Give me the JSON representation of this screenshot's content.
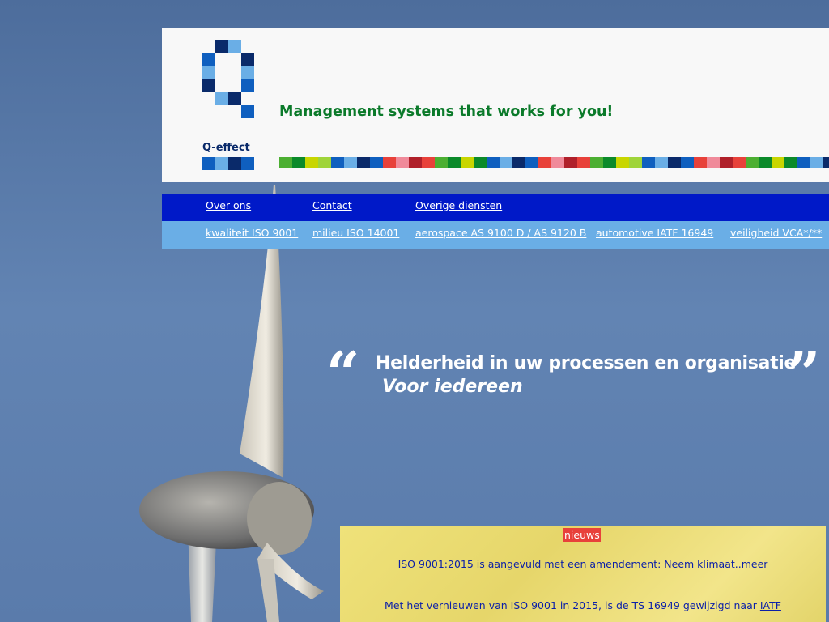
{
  "brand": {
    "name": "Q-effect",
    "tagline": "Management systems that works for you!",
    "colors": {
      "dark_blue": "#0a2a6a",
      "mid_blue": "#0f5fbf",
      "light_blue": "#6aaee6",
      "green": "#0b7a2a"
    }
  },
  "nav": {
    "primary": [
      {
        "label": "Over ons"
      },
      {
        "label": "Contact "
      },
      {
        "label": "Overige diensten "
      }
    ],
    "secondary": [
      {
        "label": "kwaliteit  ISO 9001"
      },
      {
        "label": "milieu  ISO 14001"
      },
      {
        "label": "aerospace  AS 9100 D / AS 9120 B"
      },
      {
        "label": "automotive  IATF 16949"
      },
      {
        "label": "veiligheid  VCA*/**"
      }
    ],
    "colors": {
      "top": "#0019c8",
      "bottom": "#6aaee6"
    }
  },
  "hero": {
    "quote_line1": "Helderheid in uw processen en organisatie",
    "quote_line2": "Voor iedereen",
    "open_mark": "“",
    "close_mark": "”"
  },
  "news": {
    "badge": "nieuws",
    "items": [
      {
        "text": "ISO 9001:2015 is aangevuld met een amendement: Neem klimaat..",
        "link": "meer"
      },
      {
        "text": "Met het vernieuwen van ISO 9001 in 2015, is de TS 16949 gewijzigd naar ",
        "link": "IATF"
      }
    ]
  }
}
